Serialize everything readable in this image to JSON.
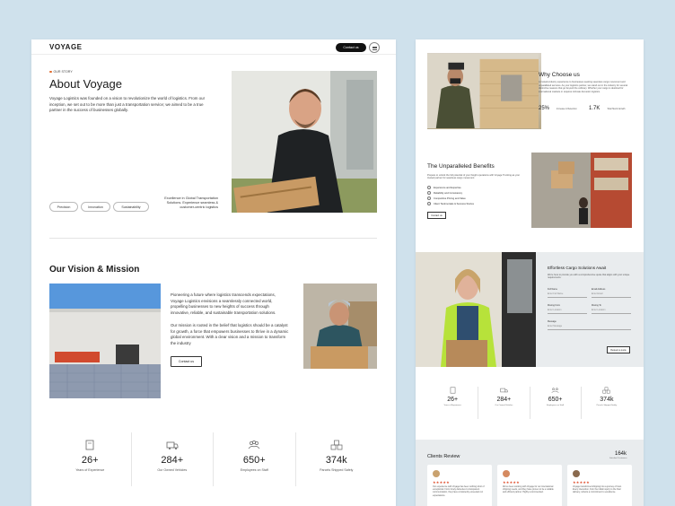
{
  "left": {
    "logo": "VOYAGE",
    "nav_button": "Contact us",
    "eyebrow": "OUR STORY",
    "title": "About Voyage",
    "intro": "Voyage Logistics was founded on a vision to revolutionize the world of logistics. From our inception, we set out to be more than just a transportation service; we aimed to be a true partner in the success of businesses globally.",
    "chips": [
      "Precision",
      "Innovation",
      "Sustainability"
    ],
    "excellence": "Excellence in Global Transportation Solutions. Experience seamless & customer-centric logistics",
    "vision_title": "Our Vision & Mission",
    "vision_p1": "Pioneering a future where logistics transcends expectations, Voyage Logistics envisions a seamlessly connected world, propelling businesses to new heights of success through innovative, reliable, and sustainable transportation solutions.",
    "vision_p2": "Our mission is rooted in the belief that logistics should be a catalyst for growth, a force that empowers businesses to thrive in a dynamic global environment. With a clear vision and a mission to transform the industry",
    "contact_button": "Contact us",
    "stats": [
      {
        "icon": "document-icon",
        "value": "26+",
        "label": "Years of Experience"
      },
      {
        "icon": "truck-icon",
        "value": "284+",
        "label": "Our Owned Vehicles"
      },
      {
        "icon": "team-icon",
        "value": "650+",
        "label": "Employees on Staff"
      },
      {
        "icon": "boxes-icon",
        "value": "374k",
        "label": "Parcels Shipped Safely"
      }
    ]
  },
  "right": {
    "why_title": "Why Choose us",
    "why_text": "A trusted-industry experience to businesses seeking seamless cargo movement and unparalleled services. As your logistics partner, we stand out in the industry for several distinctive reasons that go beyond the ordinary. Whether your cargo is destined for international markets or requires intricate domestic logistics.",
    "why_stats": [
      {
        "value": "25%",
        "label": "Increase in Retention"
      },
      {
        "value": "1.7K",
        "label": "Total Stock Growth"
      }
    ],
    "benefits_title": "The Unparalleled Benefits",
    "benefits_text": "Prepare to unlock the full potential of your freight operations with Voyage Trucking as your trusted partner for seamless cargo movement",
    "benefits": [
      "Experience and Expertise",
      "Reliability and Consistency",
      "Competitive Pricing and Value",
      "Client Testimonials & Success Stories"
    ],
    "benefits_button": "Contact us",
    "form_title": "Effortless Cargo Solutions Await",
    "form_sub": "We're here to provide you with a comprehensive quote that aligns with your unique requirements.",
    "fields": [
      {
        "label": "Full Name",
        "value": "Enter Full Name"
      },
      {
        "label": "Email Address",
        "value": "Enter Email"
      },
      {
        "label": "Moving From",
        "value": "Enter Location"
      },
      {
        "label": "Moving To",
        "value": "Enter Location"
      },
      {
        "label": "Message",
        "value": "Enter Message"
      }
    ],
    "form_button": "Request a quote",
    "stats": [
      {
        "value": "26+",
        "label": "Years of Experience"
      },
      {
        "value": "284+",
        "label": "Our Owned Vehicles"
      },
      {
        "value": "650+",
        "label": "Employees on Staff"
      },
      {
        "value": "374k",
        "label": "Parcels Shipped Safely"
      }
    ],
    "reviews_title": "Clients Review",
    "reviews_count": "164k",
    "reviews_caption": "Satisfied Customers",
    "reviews": [
      {
        "stars": "★★★★★",
        "text": "Our experience with Voyage has been nothing short of exceptional. From timely deliveries to transparent communication, they have consistently exceeded our expectations."
      },
      {
        "stars": "★★★★★",
        "text": "We've been working with Voyage for our international shipping needs, and they have proven to be a reliable and efficient partner. Highly recommended."
      },
      {
        "stars": "★★★★★",
        "text": "Voyage transformed shipping into a journey of trust. Every interaction, from the initial inquiry to the final delivery, reflects a commitment to excellence."
      }
    ]
  },
  "colors": {
    "accent": "#e06a2c",
    "background": "#cfe1ec",
    "dark": "#111111"
  }
}
